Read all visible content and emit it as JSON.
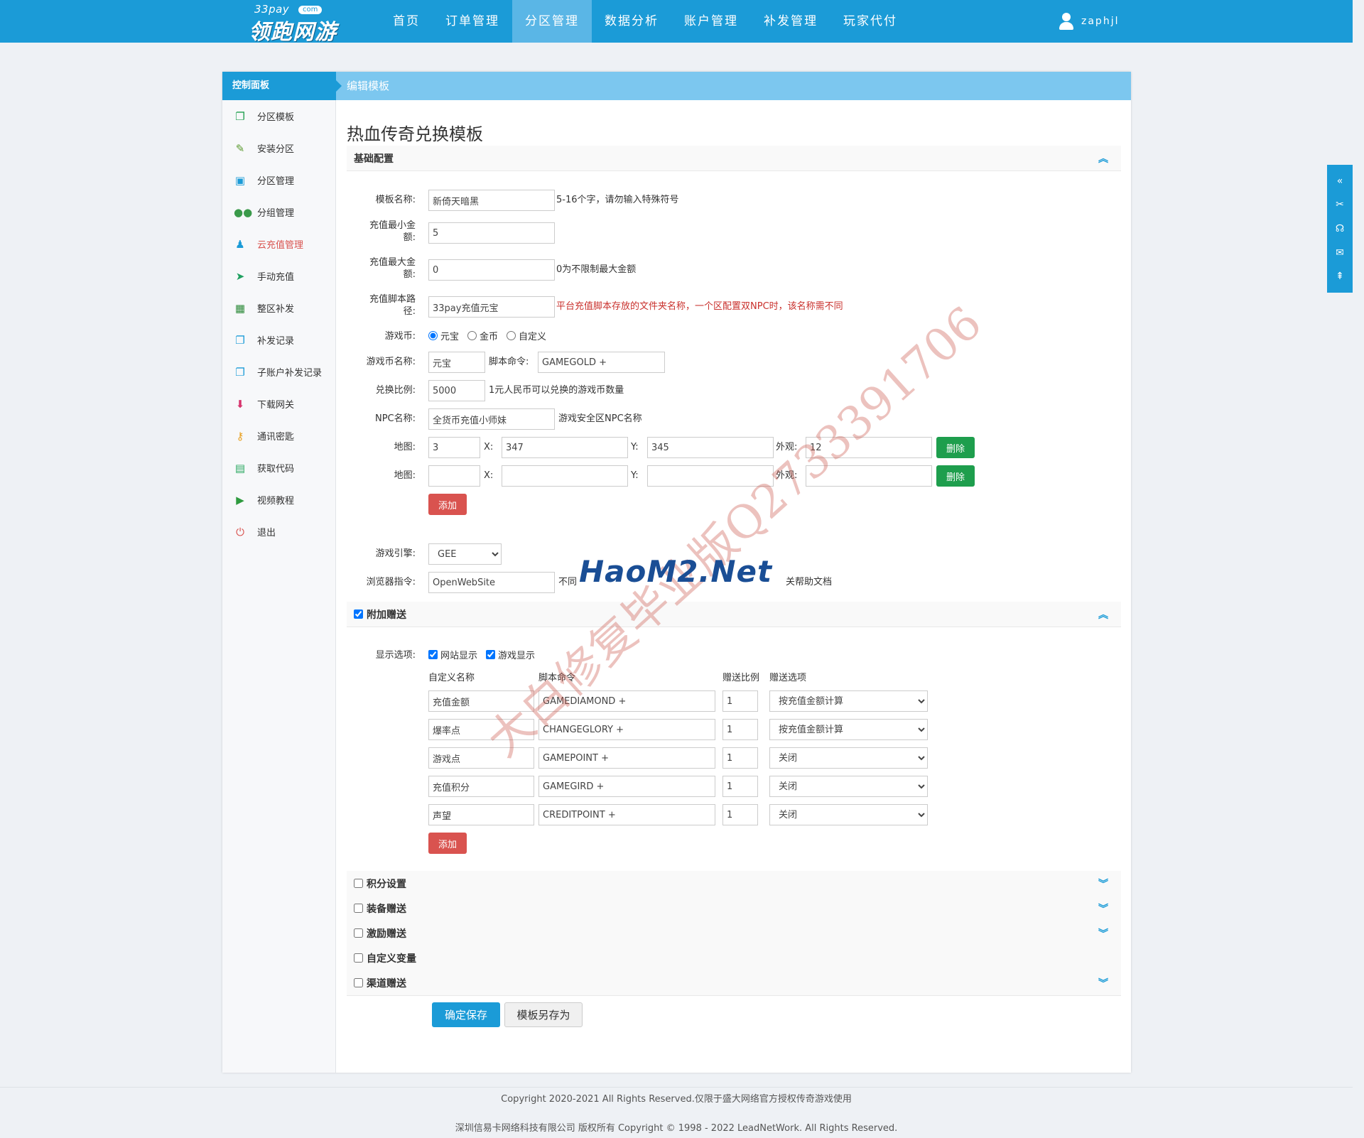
{
  "logo": {
    "small": "33pay",
    "com": "com",
    "main": "领跑网游"
  },
  "nav": [
    "首页",
    "订单管理",
    "分区管理",
    "数据分析",
    "账户管理",
    "补发管理",
    "玩家代付"
  ],
  "user": {
    "name": "zaphjl"
  },
  "panel": {
    "left_title": "控制面板",
    "right_title": "编辑模板"
  },
  "sidebar": [
    {
      "label": "分区模板",
      "icon": "copy-icon"
    },
    {
      "label": "安装分区",
      "icon": "wrench-icon"
    },
    {
      "label": "分区管理",
      "icon": "inbox-icon"
    },
    {
      "label": "分组管理",
      "icon": "group-icon"
    },
    {
      "label": "云充值管理",
      "icon": "user-icon"
    },
    {
      "label": "手动充值",
      "icon": "paper-plane-icon"
    },
    {
      "label": "整区补发",
      "icon": "calendar-icon"
    },
    {
      "label": "补发记录",
      "icon": "copy-icon"
    },
    {
      "label": "子账户补发记录",
      "icon": "copy-icon"
    },
    {
      "label": "下载网关",
      "icon": "download-icon"
    },
    {
      "label": "通讯密匙",
      "icon": "key-icon"
    },
    {
      "label": "获取代码",
      "icon": "briefcase-icon"
    },
    {
      "label": "视频教程",
      "icon": "video-icon"
    },
    {
      "label": "退出",
      "icon": "power-icon"
    }
  ],
  "page_title": "热血传奇兑换模板",
  "basic": {
    "title": "基础配置",
    "name_label": "模板名称:",
    "name_value": "新倚天暗黑",
    "name_hint": "5-16个字，请勿输入特殊符号",
    "min_label_1": "充值最小金",
    "min_label_2": "额:",
    "min_value": "5",
    "max_label_1": "充值最大金",
    "max_label_2": "额:",
    "max_value": "0",
    "max_hint": "0为不限制最大金额",
    "script_label_1": "充值脚本路",
    "script_label_2": "径:",
    "script_value": "33pay充值元宝",
    "script_hint": "平台充值脚本存放的文件夹名称，一个区配置双NPC时，该名称需不同",
    "currency_label": "游戏币:",
    "currency_options": [
      "元宝",
      "金币",
      "自定义"
    ],
    "currency_name_label": "游戏币名称:",
    "currency_name_value": "元宝",
    "script_cmd_label": "脚本命令:",
    "script_cmd_value": "GAMEGOLD +",
    "ratio_label": "兑换比例:",
    "ratio_value": "5000",
    "ratio_hint": "1元人民币可以兑换的游戏币数量",
    "npc_label": "NPC名称:",
    "npc_value": "全货币充值小师妹",
    "npc_hint": "游戏安全区NPC名称",
    "map_label": "地图:",
    "x_label": "X:",
    "y_label": "Y:",
    "look_label": "外观:",
    "map_rows": [
      {
        "map": "3",
        "x": "347",
        "y": "345",
        "look": "12"
      },
      {
        "map": "",
        "x": "",
        "y": "",
        "look": ""
      }
    ],
    "delete_label": "删除",
    "add_label": "添加",
    "engine_label": "游戏引擎:",
    "engine_value": "GEE",
    "browser_label": "浏览器指令:",
    "browser_value": "OpenWebSite",
    "browser_hint_a": "不同",
    "browser_hint_b": "关帮助文档"
  },
  "bonus": {
    "title": "附加赠送",
    "display_label": "显示选项:",
    "display_options": [
      "网站显示",
      "游戏显示"
    ],
    "headers": [
      "自定义名称",
      "脚本命令",
      "赠送比例",
      "赠送选项"
    ],
    "rows": [
      {
        "name": "充值金额",
        "cmd": "GAMEDIAMOND +",
        "ratio": "1",
        "option": "按充值金额计算"
      },
      {
        "name": "爆率点",
        "cmd": "CHANGEGLORY +",
        "ratio": "1",
        "option": "按充值金额计算"
      },
      {
        "name": "游戏点",
        "cmd": "GAMEPOINT +",
        "ratio": "1",
        "option": "关闭"
      },
      {
        "name": "充值积分",
        "cmd": "GAMEGIRD +",
        "ratio": "1",
        "option": "关闭"
      },
      {
        "name": "声望",
        "cmd": "CREDITPOINT +",
        "ratio": "1",
        "option": "关闭"
      }
    ],
    "add_label": "添加"
  },
  "collapsed_sections": [
    "积分设置",
    "装备赠送",
    "激励赠送",
    "自定义变量",
    "渠道赠送"
  ],
  "actions": {
    "save": "确定保存",
    "save_as": "模板另存为"
  },
  "footer": {
    "line1": "Copyright 2020-2021 All Rights Reserved.仅限于盛大网络官方授权传奇游戏使用",
    "line2": "深圳信易卡网络科技有限公司 版权所有 Copyright © 1998 - 2022 LeadNetWork. All Rights Reserved."
  },
  "watermarks": {
    "diagonal": "大白修复毕业版Q2733391706",
    "logo": "HaoM2.Net"
  },
  "colors": {
    "primary": "#1b9bd7",
    "danger": "#d9534f",
    "success": "#1e9e4d",
    "header_light": "#7cc7ef"
  }
}
